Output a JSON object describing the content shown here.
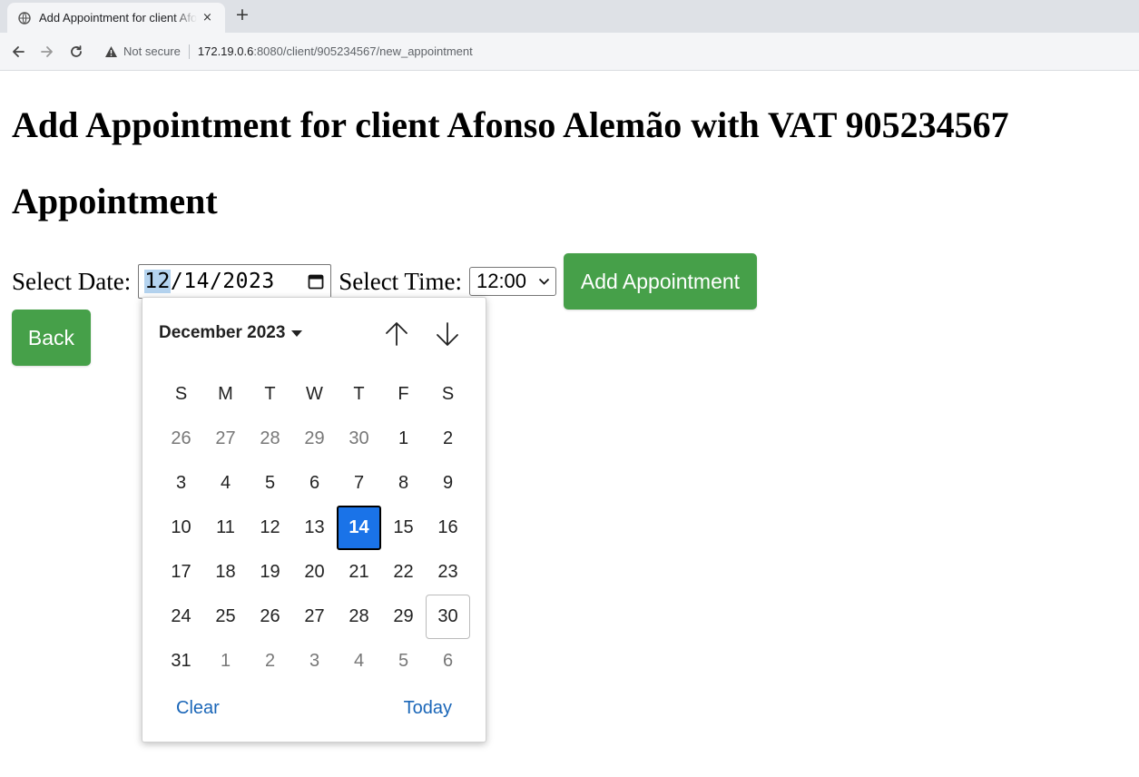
{
  "browser": {
    "tab_title": "Add Appointment for client Afonso Alemão",
    "tab_close": "×",
    "new_tab": "+",
    "security_label": "Not secure",
    "url_host": "172.19.0.6",
    "url_path": ":8080/client/905234567/new_appointment"
  },
  "page": {
    "heading": "Add Appointment for client Afonso Alemão with VAT 905234567",
    "subheading": "Appointment"
  },
  "form": {
    "date_label": "Select Date:",
    "date_month": "12",
    "date_rest": "/14/2023",
    "time_label": "Select Time:",
    "time_value": "12:00",
    "submit_label": "Add Appointment",
    "back_label": "Back"
  },
  "picker": {
    "month_label": "December 2023",
    "weekdays": [
      "S",
      "M",
      "T",
      "W",
      "T",
      "F",
      "S"
    ],
    "weeks": [
      [
        {
          "d": "26",
          "o": true
        },
        {
          "d": "27",
          "o": true
        },
        {
          "d": "28",
          "o": true
        },
        {
          "d": "29",
          "o": true
        },
        {
          "d": "30",
          "o": true
        },
        {
          "d": "1"
        },
        {
          "d": "2"
        }
      ],
      [
        {
          "d": "3"
        },
        {
          "d": "4"
        },
        {
          "d": "5"
        },
        {
          "d": "6"
        },
        {
          "d": "7"
        },
        {
          "d": "8"
        },
        {
          "d": "9"
        }
      ],
      [
        {
          "d": "10"
        },
        {
          "d": "11"
        },
        {
          "d": "12"
        },
        {
          "d": "13"
        },
        {
          "d": "14",
          "sel": true
        },
        {
          "d": "15"
        },
        {
          "d": "16"
        }
      ],
      [
        {
          "d": "17"
        },
        {
          "d": "18"
        },
        {
          "d": "19"
        },
        {
          "d": "20"
        },
        {
          "d": "21"
        },
        {
          "d": "22"
        },
        {
          "d": "23"
        }
      ],
      [
        {
          "d": "24"
        },
        {
          "d": "25"
        },
        {
          "d": "26"
        },
        {
          "d": "27"
        },
        {
          "d": "28"
        },
        {
          "d": "29"
        },
        {
          "d": "30",
          "today": true
        }
      ],
      [
        {
          "d": "31"
        },
        {
          "d": "1",
          "o": true
        },
        {
          "d": "2",
          "o": true
        },
        {
          "d": "3",
          "o": true
        },
        {
          "d": "4",
          "o": true
        },
        {
          "d": "5",
          "o": true
        },
        {
          "d": "6",
          "o": true
        }
      ]
    ],
    "clear_label": "Clear",
    "today_label": "Today"
  },
  "colors": {
    "button_green": "#46a049",
    "selected_day": "#1a73e8",
    "link_blue": "#1a66b8"
  },
  "icons": [
    "globe-icon",
    "back-arrow-icon",
    "forward-arrow-icon",
    "reload-icon",
    "warning-icon",
    "calendar-icon",
    "chevron-down-icon",
    "caret-down-icon",
    "arrow-up-icon",
    "arrow-down-icon"
  ]
}
